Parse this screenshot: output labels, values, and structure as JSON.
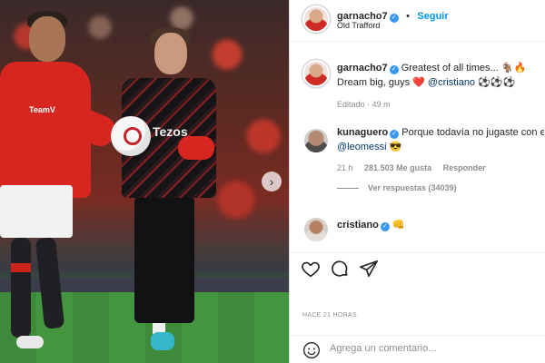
{
  "post": {
    "username": "garnacho7",
    "location": "Old Trafford",
    "follow_label": "Seguir"
  },
  "caption": {
    "username": "garnacho7",
    "text_line1": "Greatest of all times...",
    "emoji_line1": "🐐🔥",
    "text_line2": "Dream big, guys",
    "emoji_heart": "❤️",
    "mention": "@cristiano",
    "emoji_balls": "⚽⚽⚽",
    "meta_edited": "Editado",
    "meta_time": "49 m"
  },
  "comments": [
    {
      "username": "kunaguero",
      "text": "Porque todavía no jugaste con e",
      "mention": "@leomessi",
      "emoji": "😎",
      "time": "21 h",
      "likes": "281.503 Me gusta",
      "reply_label": "Responder",
      "view_replies": "Ver respuestas (34039)"
    },
    {
      "username": "cristiano",
      "emoji": "👊"
    }
  ],
  "photo": {
    "shirt_sponsor": "Tezos",
    "shirt_logo_left": "TeamV"
  },
  "actions": {
    "like_icon": "heart-outline-icon",
    "comment_icon": "comment-bubble-icon",
    "share_icon": "paper-plane-icon",
    "next_icon": "chevron-right-icon"
  },
  "timestamp": "HACE 21 HORAS",
  "comment_box": {
    "placeholder": "Agrega un comentario...",
    "emoji_icon": "smiley-icon"
  },
  "colors": {
    "link_blue": "#0095f6",
    "verified_blue": "#3897f0",
    "meta_gray": "#8e8e8e"
  }
}
